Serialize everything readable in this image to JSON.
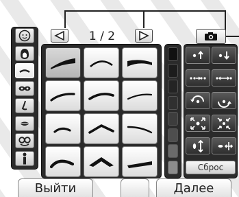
{
  "pager": {
    "prev_icon": "left-triangle-icon",
    "next_icon": "right-triangle-icon",
    "page_text": "1 / 2"
  },
  "camera": {
    "icon": "camera-icon"
  },
  "categories": [
    {
      "icon": "face-outline-icon",
      "active": false
    },
    {
      "icon": "face-shape-icon",
      "active": false
    },
    {
      "icon": "eyebrow-icon",
      "active": true
    },
    {
      "icon": "eyes-icon",
      "active": false
    },
    {
      "icon": "nose-icon",
      "active": false
    },
    {
      "icon": "mouth-icon",
      "active": false
    },
    {
      "icon": "glasses-icon",
      "active": false
    },
    {
      "icon": "figure-icon",
      "active": false
    }
  ],
  "eyebrows": [
    {
      "style": "thick-wedge",
      "selected": true
    },
    {
      "style": "thin-arch",
      "selected": false
    },
    {
      "style": "thick-wedge-right",
      "selected": false
    },
    {
      "style": "thin-curve",
      "selected": false
    },
    {
      "style": "medium-arch",
      "selected": false
    },
    {
      "style": "thin-flat",
      "selected": false
    },
    {
      "style": "small-arch",
      "selected": false
    },
    {
      "style": "peaked",
      "selected": false
    },
    {
      "style": "thin-down",
      "selected": false
    },
    {
      "style": "round-arch",
      "selected": false
    },
    {
      "style": "sharp-peak",
      "selected": false
    },
    {
      "style": "thick-straight",
      "selected": false
    }
  ],
  "colors": [
    "#111111",
    "#1c1c1c",
    "#242424",
    "#303030",
    "#3d3d3d",
    "#4e4e4e",
    "#6a6a6a",
    "#8c8c8c"
  ],
  "controls": [
    {
      "icon": "move-up-icon"
    },
    {
      "icon": "move-down-icon"
    },
    {
      "icon": "narrow-spacing-icon"
    },
    {
      "icon": "widen-spacing-icon"
    },
    {
      "icon": "rotate-ccw-icon"
    },
    {
      "icon": "rotate-cw-icon"
    },
    {
      "icon": "enlarge-icon"
    },
    {
      "icon": "shrink-icon"
    },
    {
      "icon": "stretch-vertical-icon"
    },
    {
      "icon": "stretch-horizontal-icon"
    }
  ],
  "reset_label": "Сброс",
  "exit_label": "Выйти",
  "next_label": "Далее"
}
